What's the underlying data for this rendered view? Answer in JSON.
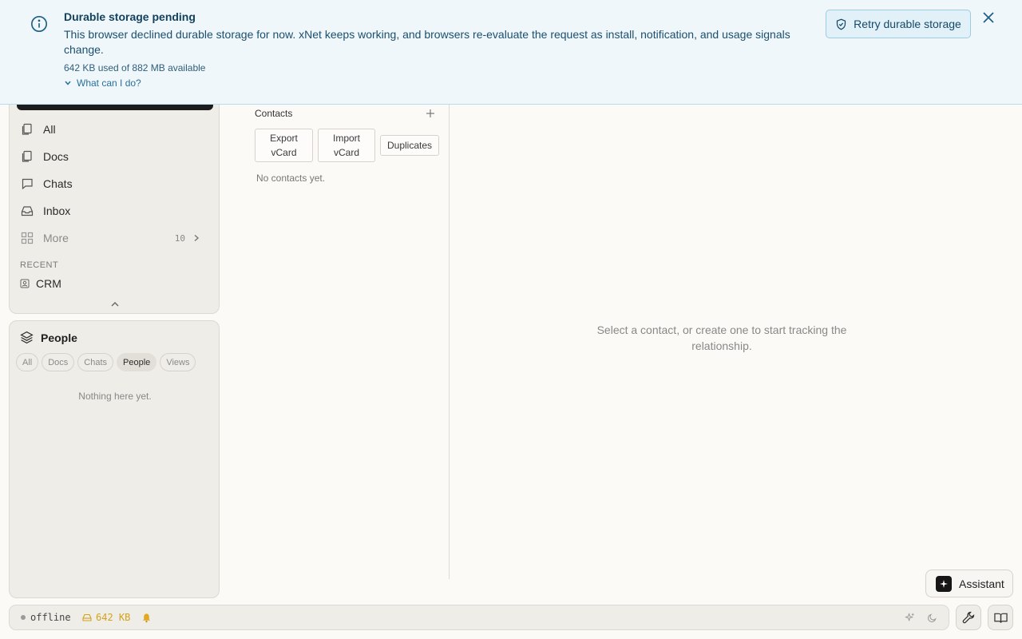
{
  "banner": {
    "title": "Durable storage pending",
    "message": "This browser declined durable storage for now. xNet keeps working, and browsers re-evaluate the request as install, notification, and usage signals change.",
    "usage": "642 KB used of 882 MB available",
    "help_link": "What can I do?",
    "retry_label": "Retry durable storage",
    "accent": "#1b4f6d"
  },
  "nav": {
    "items": [
      {
        "label": "All",
        "icon": "pages-icon"
      },
      {
        "label": "Docs",
        "icon": "docs-icon"
      },
      {
        "label": "Chats",
        "icon": "chat-bubble-icon"
      },
      {
        "label": "Inbox",
        "icon": "inbox-icon"
      },
      {
        "label": "More",
        "icon": "grid-icon",
        "count": "10"
      }
    ],
    "recent_label": "RECENT",
    "recent": [
      {
        "label": "CRM",
        "icon": "contact-card-icon"
      }
    ]
  },
  "people_panel": {
    "title": "People",
    "chips": [
      "All",
      "Docs",
      "Chats",
      "People",
      "Views"
    ],
    "active_chip": "People",
    "empty_text": "Nothing here yet."
  },
  "contacts": {
    "title": "Contacts",
    "export_label": "Export vCard",
    "import_label": "Import vCard",
    "duplicates_label": "Duplicates",
    "empty_text": "No contacts yet."
  },
  "detail": {
    "empty_text": "Select a contact, or create one to start tracking the relationship."
  },
  "assistant": {
    "label": "Assistant"
  },
  "statusbar": {
    "connection": "offline",
    "storage": "642 KB",
    "storage_color": "#d4a21a"
  }
}
